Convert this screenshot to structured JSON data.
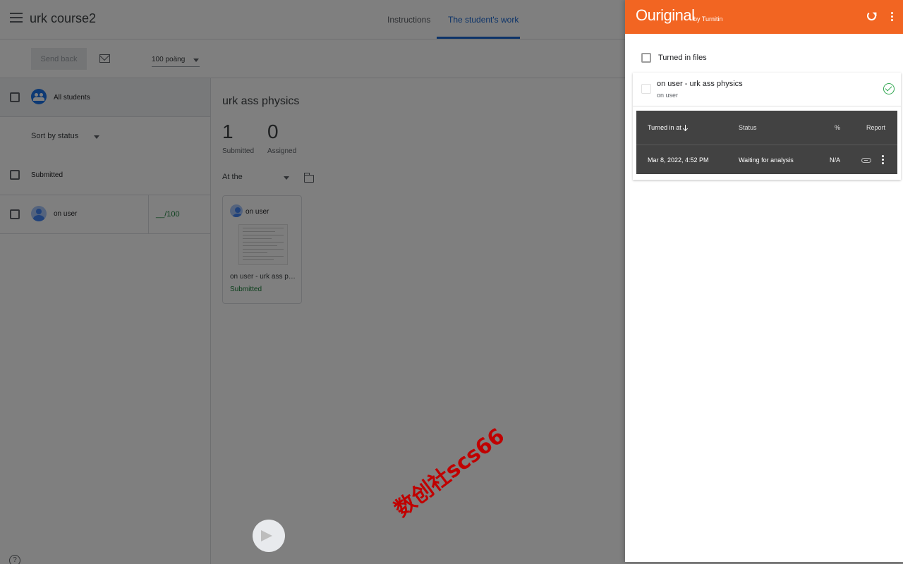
{
  "app": {
    "course_title": "urk course2",
    "tabs": [
      {
        "label": "Instructions"
      },
      {
        "label": "The student's work"
      }
    ]
  },
  "toolbar": {
    "send_back_label": "Send back",
    "points_value": "100 poäng"
  },
  "sidebar": {
    "all_students_label": "All students",
    "sort_label": "Sort by status",
    "section_label": "Submitted",
    "students": [
      {
        "name": "on user",
        "grade": "__/100"
      }
    ]
  },
  "main": {
    "assignment_title": "urk ass physics",
    "submitted_count": "1",
    "submitted_label": "Submitted",
    "assigned_count": "0",
    "assigned_label": "Assigned",
    "filter_label": "At the",
    "card": {
      "student": "on user",
      "file_name": "on user - urk ass physics",
      "status": "Submitted"
    }
  },
  "watermark": "数创社scs66",
  "panel": {
    "brand": "Ouriginal",
    "brand_sub": "by Turnitin",
    "turned_in_label": "Turned in files",
    "file": {
      "title": "on user - urk ass physics",
      "subtitle": "on user"
    },
    "table": {
      "headers": [
        "Turned in at",
        "Status",
        "%",
        "Report"
      ],
      "rows": [
        {
          "turned_in": "Mar 8, 2022, 4:52 PM",
          "status": "Waiting for analysis",
          "percent": "N/A"
        }
      ]
    },
    "colors": {
      "header": "#f26522",
      "success": "#34a853"
    }
  }
}
